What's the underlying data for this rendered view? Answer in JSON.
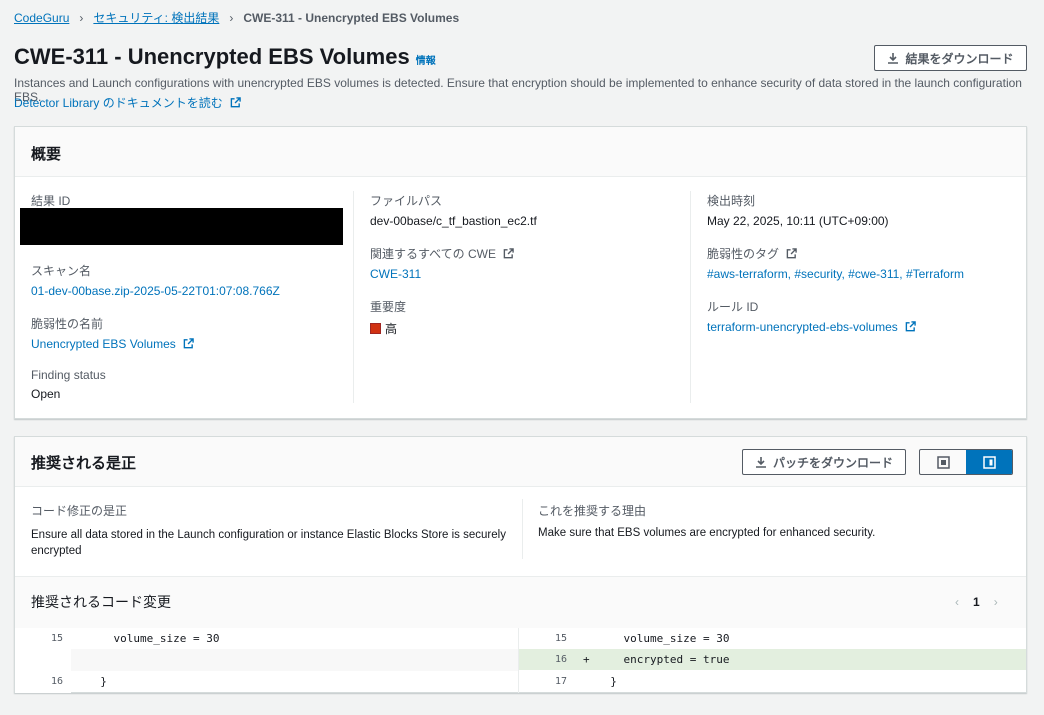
{
  "breadcrumb": {
    "items": [
      "CodeGuru",
      "セキュリティ: 検出結果"
    ],
    "current": "CWE-311 - Unencrypted EBS Volumes"
  },
  "header": {
    "title": "CWE-311 - Unencrypted EBS Volumes",
    "info_label": "情報",
    "description": "Instances and Launch configurations with unencrypted EBS volumes is detected. Ensure that encryption should be implemented to enhance security of data stored in the launch configuration EBS.",
    "doc_link": "Detector Library のドキュメントを読む",
    "download_results_label": "結果をダウンロード"
  },
  "overview": {
    "heading": "概要",
    "result_id_label": "結果 ID",
    "scan_name_label": "スキャン名",
    "scan_name": "01-dev-00base.zip-2025-05-22T01:07:08.766Z",
    "vuln_name_label": "脆弱性の名前",
    "vuln_name": "Unencrypted EBS Volumes",
    "finding_status_label": "Finding status",
    "finding_status": "Open",
    "file_path_label": "ファイルパス",
    "file_path": "dev-00base/c_tf_bastion_ec2.tf",
    "cwe_label": "関連するすべての CWE",
    "cwe": "CWE-311",
    "severity_label": "重要度",
    "severity": "高",
    "detected_label": "検出時刻",
    "detected": "May 22, 2025, 10:11 (UTC+09:00)",
    "tags_label": "脆弱性のタグ",
    "tags": "#aws-terraform, #security, #cwe-311, #Terraform",
    "rule_id_label": "ルール ID",
    "rule_id": "terraform-unencrypted-ebs-volumes"
  },
  "remediation": {
    "heading": "推奨される是正",
    "download_patch_label": "パッチをダウンロード",
    "fix_label": "コード修正の是正",
    "fix_text": "Ensure all data stored in the Launch configuration or instance Elastic Blocks Store is securely encrypted",
    "reason_label": "これを推奨する理由",
    "reason_text": "Make sure that EBS volumes are encrypted for enhanced security.",
    "code_heading": "推奨されるコード変更",
    "page": "1"
  },
  "code": {
    "left": [
      {
        "no": "15",
        "text": "    volume_size = 30"
      },
      {
        "no": "",
        "text": ""
      },
      {
        "no": "16",
        "text": "  }"
      }
    ],
    "right": [
      {
        "no": "15",
        "marker": "",
        "text": "    volume_size = 30"
      },
      {
        "no": "16",
        "marker": "+",
        "text": "    encrypted = true"
      },
      {
        "no": "17",
        "marker": "",
        "text": "  }"
      }
    ]
  },
  "colors": {
    "link": "#0073bb",
    "severity_high": "#d13212",
    "added_line_bg": "#e3efdf",
    "toggle_active": "#0073bb"
  }
}
